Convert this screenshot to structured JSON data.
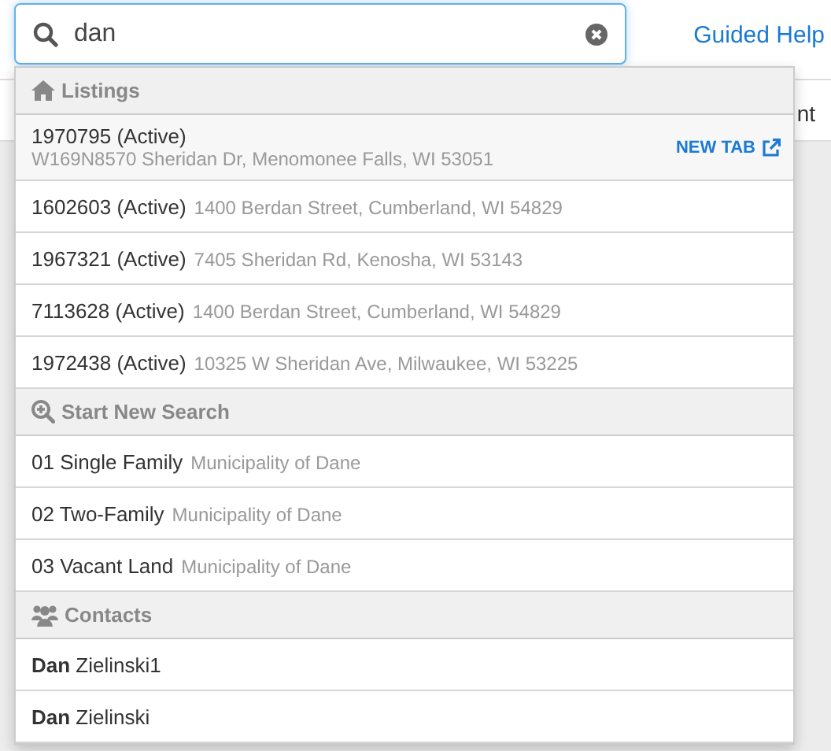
{
  "search": {
    "value": "dan"
  },
  "header_link": "Guided Help",
  "background_text": "nt",
  "groups": [
    {
      "kind": "listings",
      "title": "Listings",
      "items": [
        {
          "primary": "1970795 (Active)",
          "secondary": "W169N8570 Sheridan Dr, Menomonee Falls, WI 53051",
          "highlighted": true,
          "action": "NEW TAB"
        },
        {
          "primary": "1602603 (Active)",
          "secondary": "1400 Berdan Street, Cumberland, WI 54829",
          "highlighted": false
        },
        {
          "primary": "1967321 (Active)",
          "secondary": "7405 Sheridan Rd, Kenosha, WI 53143",
          "highlighted": false
        },
        {
          "primary": "7113628 (Active)",
          "secondary": "1400 Berdan Street, Cumberland, WI 54829",
          "highlighted": false
        },
        {
          "primary": "1972438 (Active)",
          "secondary": "10325 W Sheridan Ave, Milwaukee, WI 53225",
          "highlighted": false
        }
      ]
    },
    {
      "kind": "search",
      "title": "Start New Search",
      "items": [
        {
          "primary": "01 Single Family",
          "secondary": "Municipality of Dane",
          "highlighted": false
        },
        {
          "primary": "02 Two-Family",
          "secondary": "Municipality of Dane",
          "highlighted": false
        },
        {
          "primary": "03 Vacant Land",
          "secondary": "Municipality of Dane",
          "highlighted": false
        }
      ]
    },
    {
      "kind": "contacts",
      "title": "Contacts",
      "items": [
        {
          "primary": "**Dan** Zielinski1",
          "highlighted": false
        },
        {
          "primary": "**Dan** Zielinski",
          "highlighted": false
        }
      ]
    }
  ]
}
